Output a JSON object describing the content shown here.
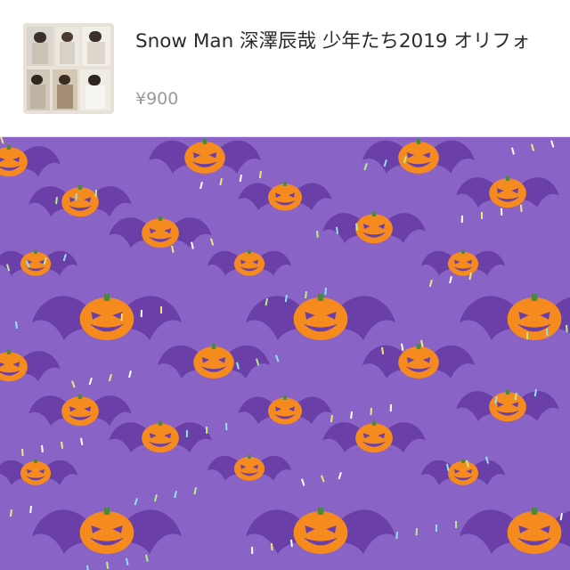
{
  "item": {
    "title": "Snow Man 深澤辰哉 少年たち2019 オリフォ",
    "price": "¥900",
    "thumbnail_icon": "product-photo-thumbnail"
  },
  "background": {
    "pattern_icon": "halloween-pumpkin-bat-pattern",
    "colors": {
      "base": "#8a63c7",
      "bat": "#6b3fa8",
      "pumpkin": "#f58a1f",
      "face": "#6b3fa8"
    }
  }
}
